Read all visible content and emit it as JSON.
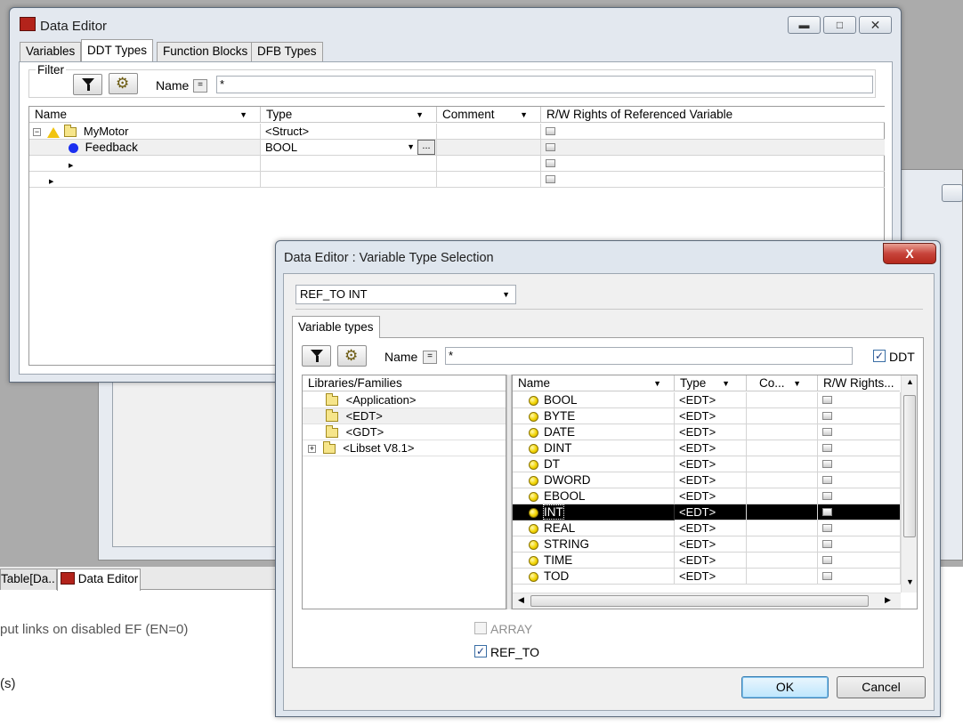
{
  "colors": {
    "selection": "#000000",
    "close_red": "#c7443b",
    "accent_blue": "#3c7fb1"
  },
  "data_editor": {
    "title": "Data Editor",
    "tabs": [
      "Variables",
      "DDT Types",
      "Function Blocks",
      "DFB Types"
    ],
    "active_tab": "DDT Types",
    "filter": {
      "group_label": "Filter",
      "name_label": "Name",
      "eq": "=",
      "value": "*"
    },
    "columns": [
      "Name",
      "Type",
      "Comment",
      "R/W Rights of Referenced Variable"
    ],
    "rows": [
      {
        "name": "MyMotor",
        "type": "<Struct>",
        "comment": ""
      },
      {
        "name": "Feedback",
        "type": "BOOL",
        "comment": "",
        "ellipsis": "..."
      }
    ]
  },
  "background": {
    "taskbar_tabs": [
      {
        "label": "Table[Da..."
      },
      {
        "label": "Data Editor"
      }
    ],
    "messages": [
      "put links on disabled EF (EN=0)",
      "(s)"
    ]
  },
  "dialog": {
    "title": "Data Editor : Variable Type Selection",
    "close_label": "X",
    "type_combo": "REF_TO INT",
    "tab_label": "Variable types",
    "filter": {
      "name_label": "Name",
      "eq": "=",
      "value": "*",
      "ddt_label": "DDT",
      "ddt_checked": true
    },
    "libraries_header": "Libraries/Families",
    "libraries": [
      "<Application>",
      "<EDT>",
      "<GDT>",
      "<Libset V8.1>"
    ],
    "selected_library": "<EDT>",
    "columns": [
      "Name",
      "Type",
      "Co...",
      "R/W Rights..."
    ],
    "types": [
      {
        "name": "BOOL",
        "type": "<EDT>"
      },
      {
        "name": "BYTE",
        "type": "<EDT>"
      },
      {
        "name": "DATE",
        "type": "<EDT>"
      },
      {
        "name": "DINT",
        "type": "<EDT>"
      },
      {
        "name": "DT",
        "type": "<EDT>"
      },
      {
        "name": "DWORD",
        "type": "<EDT>"
      },
      {
        "name": "EBOOL",
        "type": "<EDT>"
      },
      {
        "name": "INT",
        "type": "<EDT>"
      },
      {
        "name": "REAL",
        "type": "<EDT>"
      },
      {
        "name": "STRING",
        "type": "<EDT>"
      },
      {
        "name": "TIME",
        "type": "<EDT>"
      },
      {
        "name": "TOD",
        "type": "<EDT>"
      }
    ],
    "selected_type": "INT",
    "array_label": "ARRAY",
    "array_checked": false,
    "ref_to_label": "REF_TO",
    "ref_to_checked": true,
    "ok_label": "OK",
    "cancel_label": "Cancel"
  }
}
